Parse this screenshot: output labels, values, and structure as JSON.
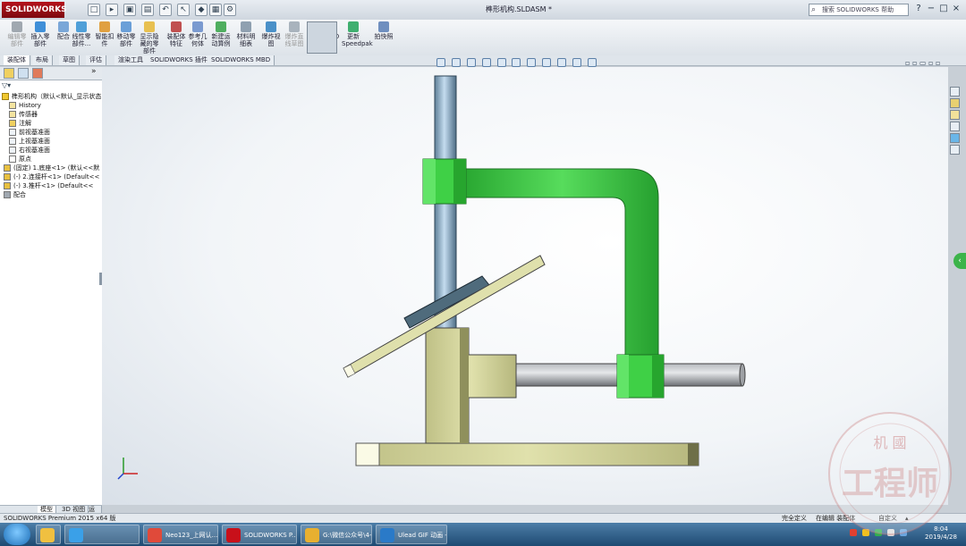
{
  "app": {
    "logo_text": "SOLIDWORKS",
    "document_title": "榫形机构.SLDASM *",
    "search_placeholder": "搜索 SOLIDWORKS 帮助",
    "window_controls": [
      "?",
      "−",
      "□",
      "×"
    ]
  },
  "command_manager": [
    {
      "label": "编辑零\n部件",
      "icon": "edit-component-icon",
      "dim": true
    },
    {
      "label": "插入零\n部件",
      "icon": "insert-component-icon"
    },
    {
      "label": "配合",
      "icon": "mate-icon"
    },
    {
      "label": "线性零\n部件...",
      "icon": "linear-pattern-icon"
    },
    {
      "label": "智能扣\n件",
      "icon": "smart-fasteners-icon"
    },
    {
      "label": "移动零\n部件",
      "icon": "move-component-icon"
    },
    {
      "label": "显示隐\n藏的零\n部件",
      "icon": "show-hidden-icon"
    },
    {
      "label": "装配体\n特征",
      "icon": "assembly-feature-icon"
    },
    {
      "label": "参考几\n何体",
      "icon": "reference-geometry-icon"
    },
    {
      "label": "新建运\n动算例",
      "icon": "new-motion-study-icon"
    },
    {
      "label": "材料明\n细表",
      "icon": "bom-icon"
    },
    {
      "label": "爆炸视\n图",
      "icon": "exploded-view-icon"
    },
    {
      "label": "爆炸直\n线草图",
      "icon": "explode-line-sketch-icon",
      "dim": true
    },
    {
      "label": "Instant3D",
      "icon": "instant3d-icon"
    },
    {
      "label": "更新\nSpeedpak",
      "icon": "speedpak-icon"
    },
    {
      "label": "拍快照",
      "icon": "snapshot-icon"
    }
  ],
  "tabs": [
    "装配体",
    "布局",
    "草图",
    "评估",
    "渲染工具",
    "SOLIDWORKS 插件",
    "SOLIDWORKS MBD"
  ],
  "active_tab": 0,
  "feature_tree": {
    "filter": "▽▾",
    "root": "榫形机构（默认<默认_显示状态",
    "items": [
      {
        "label": "History",
        "icon": "history-icon"
      },
      {
        "label": "传感器",
        "icon": "sensor-icon"
      },
      {
        "label": "注解",
        "icon": "annotations-icon"
      },
      {
        "label": "前视基准面",
        "icon": "plane-icon"
      },
      {
        "label": "上视基准面",
        "icon": "plane-icon"
      },
      {
        "label": "右视基准面",
        "icon": "plane-icon"
      },
      {
        "label": "原点",
        "icon": "origin-icon"
      },
      {
        "label": "(固定) 1.底座<1> (默认<<默",
        "icon": "part-icon"
      },
      {
        "label": "(-) 2.连接杆<1> (Default<<",
        "icon": "part-icon"
      },
      {
        "label": "(-) 3.推杆<1> (Default<<",
        "icon": "part-icon"
      },
      {
        "label": "配合",
        "icon": "mates-icon"
      }
    ]
  },
  "bottom_tabs": [
    "模型",
    "3D 视图",
    "运动算例 1"
  ],
  "status": {
    "left": "SOLIDWORKS Premium 2015 x64 版",
    "center1": "完全定义",
    "center2": "在编辑 装配体",
    "right": "自定义"
  },
  "taskbar": [
    {
      "label": "",
      "icon": "explorer-icon"
    },
    {
      "label": "",
      "icon": "browser-icon"
    },
    {
      "label": "Neo123_上网认...",
      "icon": "chrome-icon"
    },
    {
      "label": "SOLIDWORKS P...",
      "icon": "solidworks-icon"
    },
    {
      "label": "G:\\微信公众号\\4-...",
      "icon": "folder-icon"
    },
    {
      "label": "Ulead GIF 动画 -...",
      "icon": "ulead-icon"
    }
  ],
  "clock": {
    "time": "8:04",
    "date": "2019/4/28"
  },
  "watermark": {
    "top": "机 國",
    "main": "工程师"
  },
  "colors": {
    "green_part": "#35c83e",
    "yellow_part": "#d8d9a0",
    "shaft_blue": "#7fa6c4",
    "rod_gray": "#8c8f94",
    "plate_dark": "#4f6b7c"
  }
}
